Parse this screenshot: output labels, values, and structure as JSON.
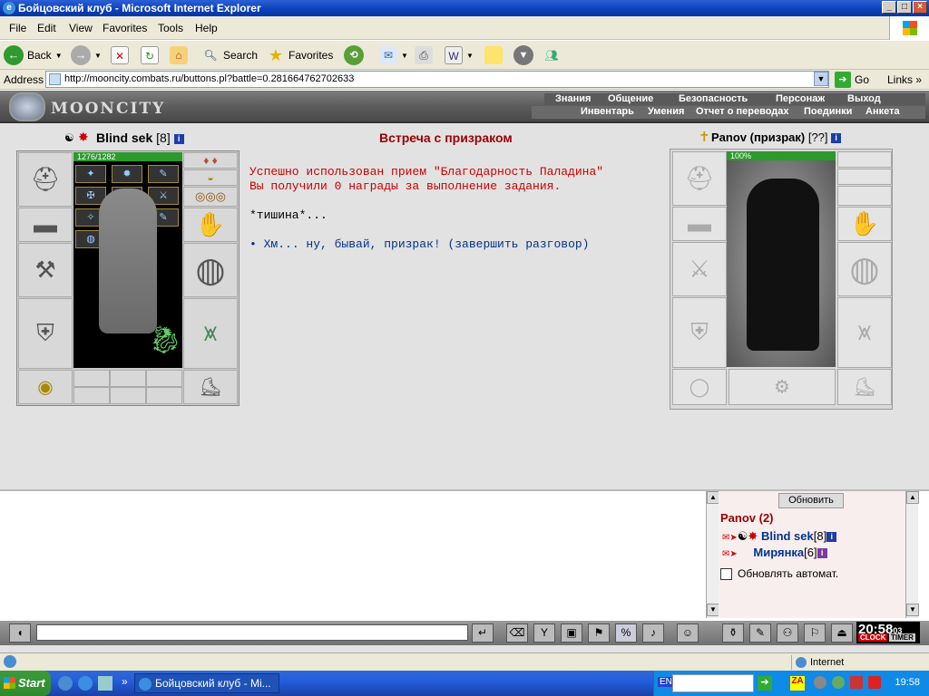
{
  "window": {
    "title": "Бойцовский клуб - Microsoft Internet Explorer"
  },
  "menu": [
    "File",
    "Edit",
    "View",
    "Favorites",
    "Tools",
    "Help"
  ],
  "toolbar": {
    "back": "Back",
    "search": "Search",
    "favorites": "Favorites"
  },
  "address": {
    "label": "Address",
    "url": "http://mooncity.combats.ru/buttons.pl?battle=0.281664762702633",
    "go": "Go",
    "links": "Links"
  },
  "game": {
    "logo": "MOONCITY",
    "nav_top": [
      "Знания",
      "Общение",
      "Безопасность",
      "Персонаж",
      "Выход"
    ],
    "nav_bottom": [
      "Инвентарь",
      "Умения",
      "Отчет о переводах",
      "Поединки",
      "Анкета"
    ]
  },
  "player": {
    "name": "Blind sek",
    "level": "[8]",
    "hp": "1276/1282",
    "hp_fraction": 0.995
  },
  "opponent": {
    "name": "Panov (призрак)",
    "level": "[??]",
    "hp": "100%"
  },
  "dialog": {
    "title": "Встреча с призраком",
    "line1": "Успешно использован прием \"Благодарность Паладина\"",
    "line2": "Вы получили 0 награды за выполнение задания.",
    "line3": "*тишина*...",
    "option": "Хм... ну, бывай, призрак! (завершить разговор)"
  },
  "roster": {
    "refresh": "Обновить",
    "location": "Panov (2)",
    "players": [
      {
        "name": "Blind sek",
        "level": "[8]"
      },
      {
        "name": "Мирянка",
        "level": "[6]"
      }
    ],
    "auto": "Обновлять автомат."
  },
  "clock": {
    "time": "20:58",
    "sec": "03",
    "clock_btn": "CLOCK",
    "timer_btn": "TIMER"
  },
  "statusbar": {
    "zone": "Internet"
  },
  "taskbar": {
    "start": "Start",
    "task": "Бойцовский клуб - Mi...",
    "time": "19:58",
    "lang": "EN"
  },
  "colors": {
    "title_red": "#990000",
    "link_blue": "#00348a",
    "hp_green": "#2b9a2b"
  }
}
